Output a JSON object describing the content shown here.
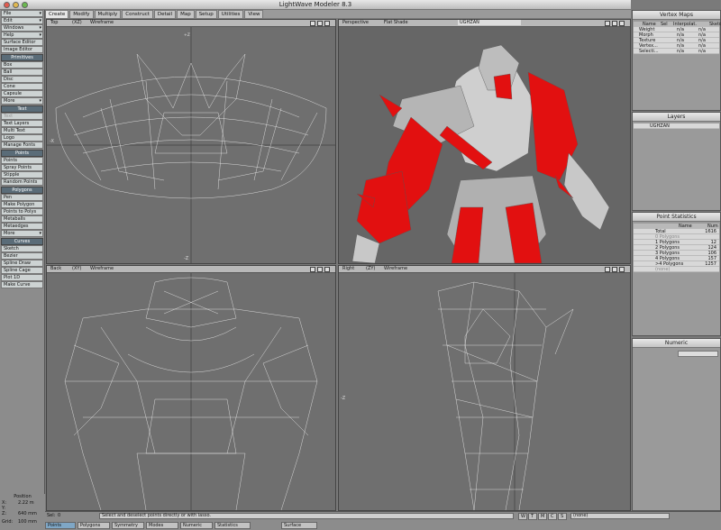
{
  "window": {
    "title": "LightWave Modeler 8.3"
  },
  "tabs": [
    "Create",
    "Modify",
    "Multiply",
    "Construct",
    "Detail",
    "Map",
    "Setup",
    "Utilities",
    "View"
  ],
  "left_panel": {
    "top_menus": [
      "File",
      "Edit",
      "Windows",
      "Help"
    ],
    "top_items": [
      "Surface Editor",
      "Image Editor"
    ],
    "sections": [
      {
        "title": "Primitives",
        "items": [
          "Box",
          "Ball",
          "Disc",
          "Cone",
          "Capsule",
          "More"
        ]
      },
      {
        "title": "Text",
        "items": [
          "Text",
          "Text Layers",
          "Multi Text",
          "Logo",
          "Manage Fonts"
        ]
      },
      {
        "title": "Points",
        "items": [
          "Points",
          "Spray Points",
          "Stipple",
          "Random Points"
        ]
      },
      {
        "title": "Polygons",
        "items": [
          "Pen",
          "Make Polygon",
          "Points to Polys",
          "Metaballs",
          "Metaedges",
          "More"
        ]
      },
      {
        "title": "Curves",
        "items": [
          "Sketch",
          "Bezier",
          "Spline Draw",
          "Spline Cage",
          "Plot 1D",
          "Make Curve"
        ]
      }
    ],
    "position": {
      "label": "Position",
      "x_label": "X:",
      "x": "2.22 m",
      "y_label": "Y:",
      "z_label": "Z:",
      "z": "640 mm",
      "grid_label": "Grid:",
      "grid": "100 mm"
    }
  },
  "viewports": {
    "top": {
      "view": "Top",
      "axes": "(XZ)",
      "mode": "Wireframe",
      "axis_top": "+Z",
      "axis_left": "-X",
      "axis_bottom": "-Z"
    },
    "perspective": {
      "view": "Perspective",
      "mode": "Flat Shade",
      "object": "UGHZAN"
    },
    "back": {
      "view": "Back",
      "axes": "(XY)",
      "mode": "Wireframe"
    },
    "right": {
      "view": "Right",
      "axes": "(ZY)",
      "mode": "Wireframe",
      "axis_left": "-Z"
    }
  },
  "vertex_maps": {
    "title": "Vertex Maps",
    "headers": [
      "Name",
      "Sel",
      "Interpolat.",
      "Sketc"
    ],
    "rows": [
      [
        "Weight",
        "n/a",
        "n/a"
      ],
      [
        "Morph",
        "n/a",
        "n/a"
      ],
      [
        "Texture",
        "n/a",
        "n/a"
      ],
      [
        "Vertex...",
        "n/a",
        "n/a"
      ],
      [
        "Selecti...",
        "n/a",
        "n/a"
      ]
    ]
  },
  "layers": {
    "title": "Layers",
    "layer": "UGHZAN"
  },
  "point_stats": {
    "title": "Point Statistics",
    "headers": [
      "Name",
      "Num"
    ],
    "rows": [
      [
        "Total",
        "1616"
      ],
      [
        "0 Polygons",
        ""
      ],
      [
        "1 Polygons",
        "12"
      ],
      [
        "2 Polygons",
        "124"
      ],
      [
        "3 Polygons",
        "106"
      ],
      [
        "4 Polygons",
        "157"
      ],
      [
        ">4 Polygons",
        "1257"
      ],
      [
        "(none)",
        ""
      ]
    ]
  },
  "numeric": {
    "title": "Numeric"
  },
  "status": {
    "sel_label": "Sel:",
    "sel_value": "0",
    "message": "Select and deselect points directly or with lasso.",
    "modes": [
      "Points",
      "Polygons",
      "Symmetry",
      "Modes",
      "Numeric",
      "Statistics"
    ],
    "surface": "Surface",
    "vertex": "(none)",
    "vmap_buttons": [
      "W",
      "T",
      "M",
      "C",
      "S"
    ]
  },
  "colors": {
    "accent_red": "#e21010",
    "model_grey": "#c8c8c8",
    "panel_bg": "#9a9a9a"
  }
}
